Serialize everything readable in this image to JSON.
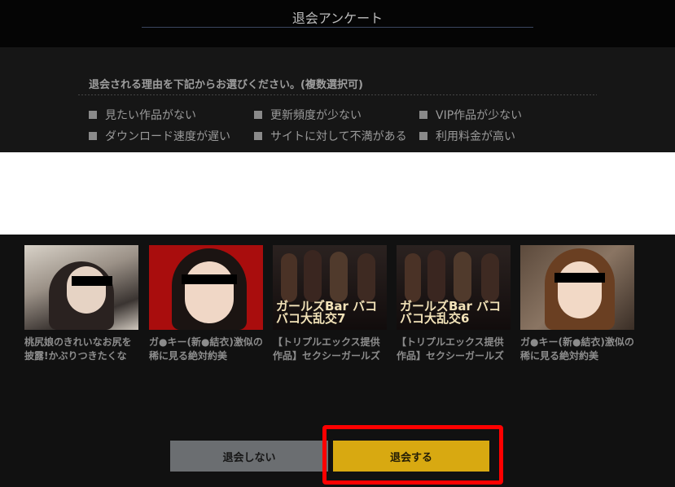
{
  "header": {
    "title": "退会アンケート"
  },
  "survey": {
    "question": "退会される理由を下記からお選びください。(複数選択可)",
    "options": [
      "見たい作品がない",
      "更新頻度が少ない",
      "VIP作品が少ない",
      "ダウンロード速度が遅い",
      "サイトに対して不満がある",
      "利用料金が高い"
    ]
  },
  "thumbnails": [
    {
      "caption": "桃尻娘のきれいなお尻を披露!かぶりつきたくな"
    },
    {
      "caption": "ガ●キー(新●結衣)激似の稀に見る絶対約美"
    },
    {
      "caption": "【トリプルエックス提供作品】セクシーガールズ",
      "image_text": "ガールズBar バコバコ大乱交7"
    },
    {
      "caption": "【トリプルエックス提供作品】セクシーガールズ",
      "image_text": "ガールズBar バコバコ大乱交6"
    },
    {
      "caption": "ガ●キー(新●結衣)激似の稀に見る絶対約美"
    }
  ],
  "buttons": {
    "cancel": "退会しない",
    "confirm": "退会する"
  },
  "colors": {
    "confirm_button": "#d8a911",
    "highlight_border": "#ff0000",
    "cancel_button": "#6b6e71"
  }
}
